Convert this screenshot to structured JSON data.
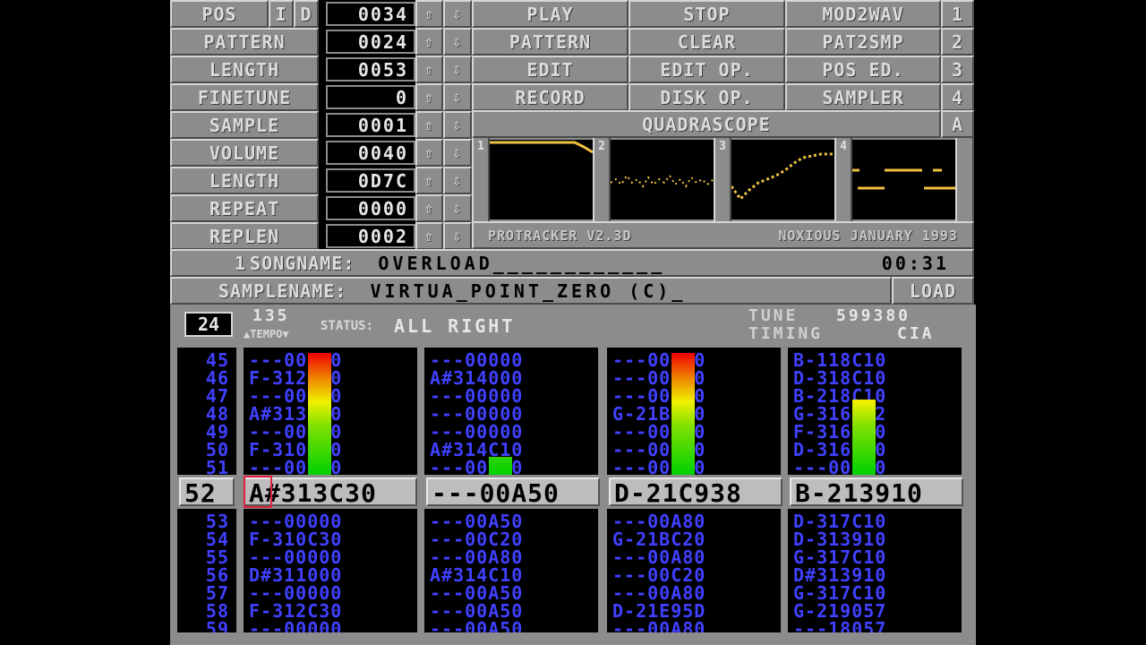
{
  "top": {
    "rows": [
      {
        "label": "POS",
        "extra": [
          "I",
          "D"
        ],
        "value": "0034"
      },
      {
        "label": "PATTERN",
        "value": "0024"
      },
      {
        "label": "LENGTH",
        "value": "0053"
      },
      {
        "label": "FINETUNE",
        "value": "0"
      },
      {
        "label": "SAMPLE",
        "value": "0001"
      },
      {
        "label": "VOLUME",
        "value": "0040"
      },
      {
        "label": "LENGTH",
        "value": "0D7C"
      },
      {
        "label": "REPEAT",
        "value": "0000"
      },
      {
        "label": "REPLEN",
        "value": "0002"
      }
    ],
    "buttons": [
      [
        "PLAY",
        "STOP",
        "MOD2WAV",
        "1"
      ],
      [
        "PATTERN",
        "CLEAR",
        "PAT2SMP",
        "2"
      ],
      [
        "EDIT",
        "EDIT OP.",
        "POS ED.",
        "3"
      ],
      [
        "RECORD",
        "DISK OP.",
        "SAMPLER",
        "4"
      ]
    ],
    "quadrascope_label": "QUADRASCOPE",
    "quadrascope_key": "A",
    "scope_channels": [
      "1",
      "2",
      "3",
      "4"
    ],
    "version_text": "PROTRACKER V2.3D",
    "credit_text": "NOXIOUS JANUARY 1993"
  },
  "song": {
    "number": "1",
    "songname_label": "SONGNAME:",
    "songname_value": "OVERLOAD____________",
    "time": "00:31",
    "samplename_label": "SAMPLENAME:",
    "samplename_value": "VIRTUA_POINT_ZERO (C)_",
    "load_label": "LOAD"
  },
  "status": {
    "pattern_number": "24",
    "tempo": "135",
    "tempo_label": "TEMPO",
    "status_label": "STATUS:",
    "status_value": "ALL RIGHT",
    "tune_label": "TUNE",
    "tune_value": "599380",
    "timing_label": "TIMING",
    "timing_value": "CIA"
  },
  "pattern": {
    "row_numbers_before": [
      "45",
      "46",
      "47",
      "48",
      "49",
      "50",
      "51"
    ],
    "current_row": "52",
    "row_numbers_after": [
      "53",
      "54",
      "55",
      "56",
      "57",
      "58",
      "59"
    ],
    "channels": [
      {
        "before": [
          "---00000",
          "F-312C20",
          "---00000",
          "A#313C20",
          "---00000",
          "F-310000",
          "---00000"
        ],
        "current": "A#313C30",
        "after": [
          "---00000",
          "F-310C30",
          "---00000",
          "D#311000",
          "---00000",
          "F-312C30",
          "---00000"
        ],
        "vu": 1.0
      },
      {
        "before": [
          "---00000",
          "A#314000",
          "---00000",
          "---00000",
          "---00000",
          "A#314C10",
          "---00A50"
        ],
        "current": "---00A50",
        "after": [
          "---00A50",
          "---00C20",
          "---00A80",
          "A#314C10",
          "---00A50",
          "---00A50",
          "---00A50"
        ],
        "vu": 0.15
      },
      {
        "before": [
          "---00000",
          "---00000",
          "---00000",
          "G-21BC20",
          "---00A80",
          "---00C30",
          "---00A80"
        ],
        "current": "D-21C938",
        "after": [
          "---00A80",
          "G-21BC20",
          "---00A80",
          "---00C20",
          "---00A80",
          "D-21E95D",
          "---00A80"
        ],
        "vu": 1.0
      },
      {
        "before": [
          "B-118C10",
          "D-318C10",
          "B-218C10",
          "G-316452",
          "F-316400",
          "D-316C20",
          "---00C10"
        ],
        "current": "B-213910",
        "after": [
          "D-317C10",
          "D-313910",
          "G-317C10",
          "D#313910",
          "G-317C10",
          "G-219057",
          "---18057"
        ],
        "vu": 0.62
      }
    ]
  }
}
